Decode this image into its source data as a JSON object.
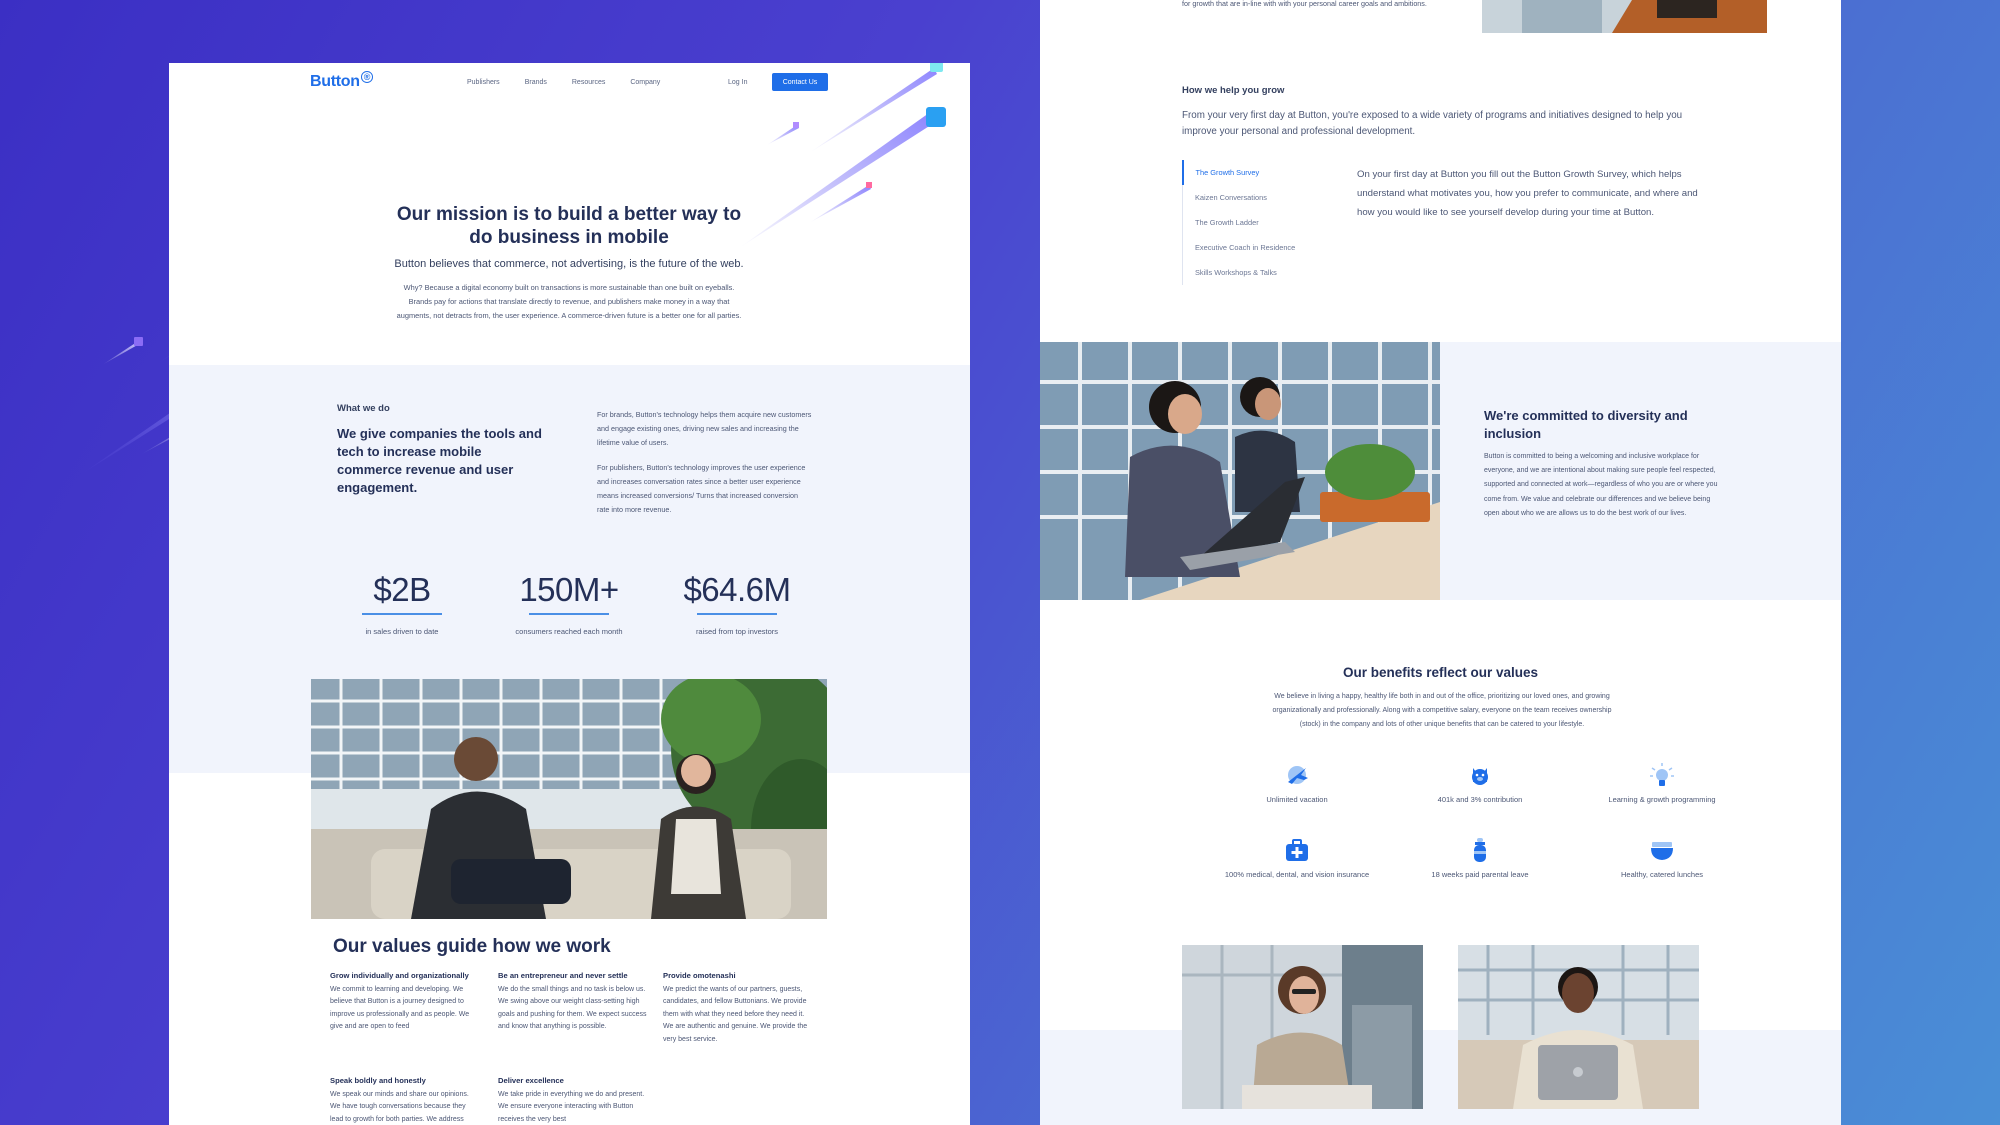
{
  "colors": {
    "accent": "#1f6ee8",
    "heading": "#243058",
    "background_gradient_start": "#3b2fc4",
    "background_gradient_end": "#4a8fd6",
    "band": "#f1f4fc"
  },
  "left": {
    "nav": {
      "logo": "Button",
      "links": [
        "Publishers",
        "Brands",
        "Resources",
        "Company"
      ],
      "login": "Log In",
      "contact": "Contact Us"
    },
    "mission": {
      "title": "Our mission is to build a better way to do business in mobile",
      "subtitle": "Button believes that commerce, not advertising, is the future of the web.",
      "body": "Why? Because a digital economy built on transactions is more sustainable than one built on eyeballs. Brands pay for actions that translate directly to revenue, and publishers make money in a way that augments, not detracts from, the user experience. A commerce-driven future is a better one for all parties."
    },
    "what_we_do": {
      "kicker": "What we do",
      "heading": "We give companies the tools and tech to increase mobile commerce revenue and user engagement.",
      "brands": "For brands, Button's technology helps them acquire new customers and engage existing ones, driving new sales and increasing the lifetime value of users.",
      "publishers": "For publishers, Button's technology improves the user experience and increases conversation rates since a better user experience means increased conversions/ Turns that increased conversion rate into more revenue."
    },
    "stats": [
      {
        "value": "$2B",
        "label": "in sales driven to date"
      },
      {
        "value": "150M+",
        "label": "consumers reached each month"
      },
      {
        "value": "$64.6M",
        "label": "raised from top investors"
      }
    ],
    "values": {
      "title": "Our values guide how we work",
      "items": [
        {
          "title": "Grow individually and organizationally",
          "text": "We commit to learning and developing. We believe that Button is a journey designed to improve us professionally and as people. We give and are open to feed"
        },
        {
          "title": "Be an entrepreneur and never settle",
          "text": "We do the small things and no task is below us. We swing above our weight class-setting high goals and pushing for them. We expect success and know that anything is possible."
        },
        {
          "title": "Provide omotenashi",
          "text": "We predict the wants of our partners, guests, candidates, and fellow Buttonians. We provide them with what they need before they need it. We are authentic and genuine. We provide the very best service."
        },
        {
          "title": "Speak boldly and honestly",
          "text": "We speak our minds and share our opinions. We have tough conversations because they lead to growth for both parties. We address"
        },
        {
          "title": "Deliver excellence",
          "text": "We take pride in everything we do and present. We ensure everyone interacting with Button receives the very best"
        }
      ]
    }
  },
  "right": {
    "top_text": "for growth that are in-line with with your personal career goals and ambitions.",
    "help": {
      "kicker": "How we help you grow",
      "text": "From your very first day at Button, you're exposed to a wide variety of programs and initiatives designed to help you improve your personal and professional development.",
      "tabs": [
        "The Growth Survey",
        "Kaizen Conversations",
        "The Growth Ladder",
        "Executive Coach in Residence",
        "Skills Workshops & Talks"
      ],
      "active_tab": "The Growth Survey",
      "tab_body": "On your first day at Button you fill out the Button Growth Survey, which helps understand what motivates you, how you prefer to communicate, and where and how you would like to see yourself develop during your time at Button."
    },
    "diversity": {
      "title": "We're committed to diversity and inclusion",
      "text": "Button is committed to being a welcoming and inclusive workplace for everyone, and we are intentional about making sure people feel respected, supported and connected at work—regardless of who you are or where you come from. We value and celebrate our differences and we believe being open about who we are allows us to do the best work of our lives."
    },
    "benefits": {
      "title": "Our benefits reflect our values",
      "text": "We believe in living a happy, healthy life both in and out of the office, prioritizing our loved ones, and growing organizationally and professionally. Along with a competitive salary, everyone on the team receives ownership (stock) in the company and lots of other unique benefits that can be catered to your lifestyle.",
      "items": [
        {
          "label": "Unlimited vacation",
          "icon": "airplane-icon"
        },
        {
          "label": "401k and 3% contribution",
          "icon": "piggy-bank-icon"
        },
        {
          "label": "Learning & growth programming",
          "icon": "lightbulb-icon"
        },
        {
          "label": "100% medical, dental, and vision insurance",
          "icon": "medical-kit-icon"
        },
        {
          "label": "18 weeks paid parental leave",
          "icon": "baby-bottle-icon"
        },
        {
          "label": "Healthy, catered lunches",
          "icon": "food-bowl-icon"
        }
      ]
    }
  }
}
